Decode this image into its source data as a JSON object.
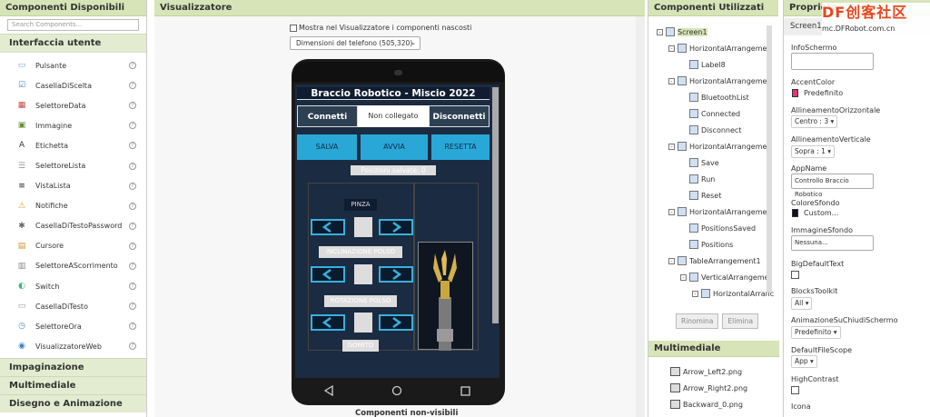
{
  "palette": {
    "title": "Componenti Disponibili",
    "search_placeholder": "Search Components...",
    "section": "Interfaccia utente",
    "items": [
      {
        "label": "Pulsante",
        "icon": "button-icon"
      },
      {
        "label": "CasellaDiScelta",
        "icon": "checkbox-icon"
      },
      {
        "label": "SelettoreData",
        "icon": "datepicker-icon"
      },
      {
        "label": "Immagine",
        "icon": "image-icon"
      },
      {
        "label": "Etichetta",
        "icon": "label-icon"
      },
      {
        "label": "SelettoreLista",
        "icon": "listpicker-icon"
      },
      {
        "label": "VistaLista",
        "icon": "listview-icon"
      },
      {
        "label": "Notifiche",
        "icon": "warning-icon"
      },
      {
        "label": "CasellaDiTestoPassword",
        "icon": "password-icon"
      },
      {
        "label": "Cursore",
        "icon": "slider-icon"
      },
      {
        "label": "SelettoreAScorrimento",
        "icon": "spinner-icon"
      },
      {
        "label": "Switch",
        "icon": "switch-icon"
      },
      {
        "label": "CasellaDiTesto",
        "icon": "textbox-icon"
      },
      {
        "label": "SelettoreOra",
        "icon": "timepicker-icon"
      },
      {
        "label": "VisualizzatoreWeb",
        "icon": "globe-icon"
      }
    ],
    "groups": [
      "Impaginazione",
      "Multimediale",
      "Disegno e Animazione"
    ]
  },
  "viewer": {
    "title": "Visualizzatore",
    "show_hidden_label": "Mostra nel Visualizzatore i componenti nascosti",
    "phone_size": "Dimensioni del telefono (505,320)",
    "nonvisible_label": "Componenti non-visibili",
    "app": {
      "title": "Braccio Robotico - Miscio 2022",
      "connect_btn": "Connetti",
      "status": "Non collegato",
      "disconnect_btn": "Disconnetti",
      "save_btn": "SALVA",
      "run_btn": "AVVIA",
      "reset_btn": "RESETTA",
      "positions_label": "Posizioni salvate: 0",
      "pinza_label": "PINZA",
      "wrist_tilt_label": "INCLINAZIONE POLSO",
      "wrist_rotation_label": "ROTAZIONE POLSO",
      "gomito_label": "GOMITO"
    }
  },
  "components": {
    "title": "Componenti Utilizzati",
    "tree": [
      {
        "label": "Screen1",
        "depth": 0,
        "toggle": "-",
        "selected": true
      },
      {
        "label": "HorizontalArrangemen",
        "depth": 1,
        "toggle": "-"
      },
      {
        "label": "Label8",
        "depth": 2,
        "toggle": ""
      },
      {
        "label": "HorizontalArrangemen",
        "depth": 1,
        "toggle": "-"
      },
      {
        "label": "BluetoothList",
        "depth": 2,
        "toggle": ""
      },
      {
        "label": "Connected",
        "depth": 2,
        "toggle": ""
      },
      {
        "label": "Disconnect",
        "depth": 2,
        "toggle": ""
      },
      {
        "label": "HorizontalArrangemen",
        "depth": 1,
        "toggle": "-"
      },
      {
        "label": "Save",
        "depth": 2,
        "toggle": ""
      },
      {
        "label": "Run",
        "depth": 2,
        "toggle": ""
      },
      {
        "label": "Reset",
        "depth": 2,
        "toggle": ""
      },
      {
        "label": "HorizontalArrangemen",
        "depth": 1,
        "toggle": "-"
      },
      {
        "label": "PositionsSaved",
        "depth": 2,
        "toggle": ""
      },
      {
        "label": "Positions",
        "depth": 2,
        "toggle": ""
      },
      {
        "label": "TableArrangement1",
        "depth": 1,
        "toggle": "-"
      },
      {
        "label": "VerticalArrangemer",
        "depth": 2,
        "toggle": "-"
      },
      {
        "label": "HorizontalArranc",
        "depth": 3,
        "toggle": "-"
      }
    ],
    "rename_btn": "Rinomina",
    "delete_btn": "Elimina",
    "media_title": "Multimediale",
    "media": [
      "Arrow_Left2.png",
      "Arrow_Right2.png",
      "Backward_0.png"
    ]
  },
  "properties": {
    "title": "Proprietà",
    "component": "Screen1",
    "info_label": "InfoSchermo",
    "accent_label": "AccentColor",
    "accent_value": "Predefinito",
    "accent_color": "#e8336d",
    "halign_label": "AllineamentoOrizzontale",
    "halign_value": "Centro : 3",
    "valign_label": "AllineamentoVerticale",
    "valign_value": "Sopra : 1",
    "appname_label": "AppName",
    "appname_value": "Controllo Braccio Robotico",
    "bg_label": "ColoreSfondo",
    "bg_value": "Custom...",
    "bg_color": "#101020",
    "bgimage_label": "ImmagineSfondo",
    "bgimage_value": "Nessuna...",
    "bigtext_label": "BigDefaultText",
    "toolkit_label": "BlocksToolkit",
    "toolkit_value": "All",
    "anim_label": "AnimazioneSuChiudiSchermo",
    "anim_value": "Predefinito",
    "filescope_label": "DefaultFileScope",
    "filescope_value": "App",
    "contrast_label": "HighContrast",
    "icon_label": "Icona"
  },
  "watermark": {
    "main": "DF创客社区",
    "sub": "mc.DFRobot.com.cn"
  }
}
